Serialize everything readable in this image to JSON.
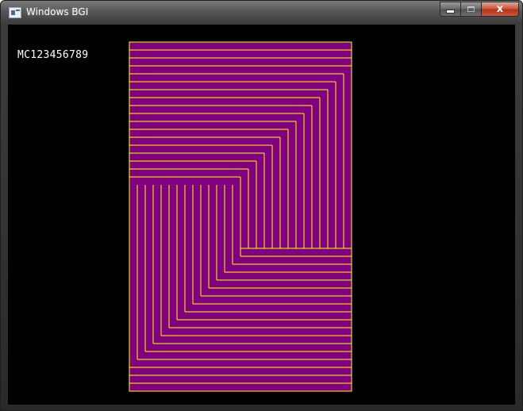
{
  "window": {
    "title": "Windows BGI",
    "icon": "app-window-icon",
    "controls": {
      "minimize_icon": "minimize-icon",
      "maximize_icon": "maximize-icon",
      "close_icon": "close-icon",
      "close_glyph": "x"
    }
  },
  "canvas": {
    "label_text": "MC123456789",
    "fill_color": "#800080",
    "line_color": "#ffff00",
    "background_color": "#000000"
  }
}
